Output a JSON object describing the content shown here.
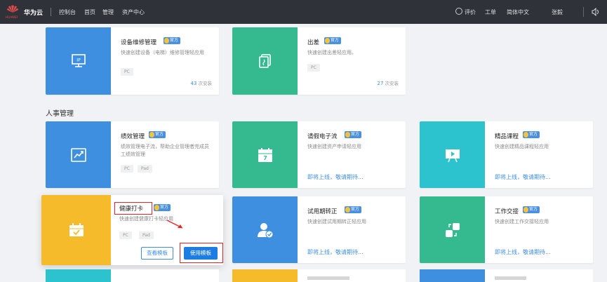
{
  "topbar": {
    "brand": "华为云",
    "brand_sub": "HUAWEI",
    "nav": [
      "控制台",
      "首页",
      "管理",
      "资产中心"
    ],
    "right": {
      "feedback": "评价",
      "tickets": "工单",
      "language": "简体中文",
      "user": "张毅"
    }
  },
  "badge_label": "官方",
  "top_cards": [
    {
      "title": "设备维修管理",
      "desc": "快速创建设备（电梯）维修管理轻应用",
      "tags": [
        "PC"
      ],
      "installs_num": "43",
      "installs_unit": "次安装",
      "icon": "computer-ip-icon",
      "color": "#3e8fdf"
    },
    {
      "title": "出差",
      "desc": "快速创建出差轻应用。",
      "tags": [
        "PC"
      ],
      "installs_num": "27",
      "installs_unit": "次安装",
      "icon": "document-copy-icon",
      "color": "#35b98e"
    }
  ],
  "section": {
    "title": "人事管理"
  },
  "row1": [
    {
      "title": "绩效管理",
      "desc": "绩效管理电子流，帮助企业管理者完成员工绩效管理",
      "tags": [
        "PC",
        "Pad"
      ],
      "icon": "trend-chart-icon",
      "color": "#3e8fdf"
    },
    {
      "title": "请假电子流",
      "desc": "快速创建资产申请轻应用",
      "soon": "即将上线，敬请期待...",
      "icon": "calendar-icon",
      "color": "#35b98e"
    },
    {
      "title": "精品课程",
      "desc": "快速创建精品课程轻应用",
      "soon": "即将上线，敬请期待...",
      "icon": "presentation-icon",
      "color": "#2cc3cf"
    }
  ],
  "row2": [
    {
      "title": "健康打卡",
      "desc": "快速创建健康打卡轻应用",
      "tags": [
        "PC",
        "Pad"
      ],
      "icon": "calendar-check-icon",
      "color": "#f6bb2b",
      "view_button": "查看模板",
      "use_button": "使用模板"
    },
    {
      "title": "试用期转正",
      "desc": "快速创建试用期转正轻应用",
      "soon": "即将上线，敬请期待...",
      "icon": "user-check-icon",
      "color": "#3e8fdf"
    },
    {
      "title": "工作交接",
      "desc": "快速创建工作交接轻应用",
      "soon": "即将上线，敬请期待...",
      "icon": "handover-icon",
      "color": "#35b98e"
    }
  ]
}
